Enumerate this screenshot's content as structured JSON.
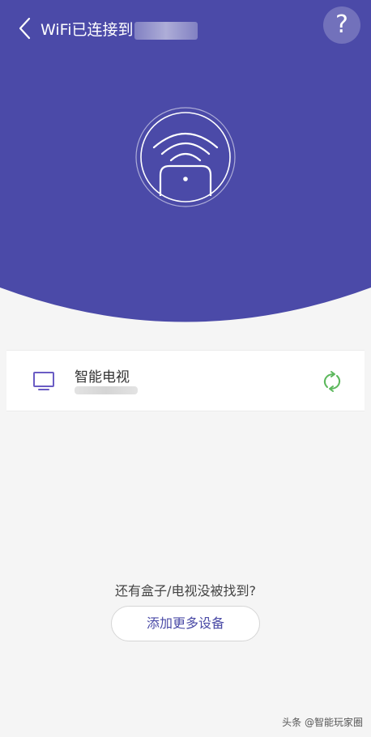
{
  "colors": {
    "header_bg": "#4b4aa8",
    "page_bg": "#f5f5f5",
    "accent_text": "#4a4aa6",
    "refresh_green": "#5cb85c"
  },
  "topbar": {
    "title": "WiFi已连接到",
    "back_icon": "chevron-left-icon",
    "help_label": "?"
  },
  "hero": {
    "icon": "wifi-router-icon"
  },
  "devices": [
    {
      "name": "智能电视",
      "icon": "tv-icon",
      "action_icon": "refresh-icon"
    }
  ],
  "footer": {
    "prompt": "还有盒子/电视没被找到?",
    "add_button": "添加更多设备"
  },
  "watermark": "头条 @智能玩家圈"
}
